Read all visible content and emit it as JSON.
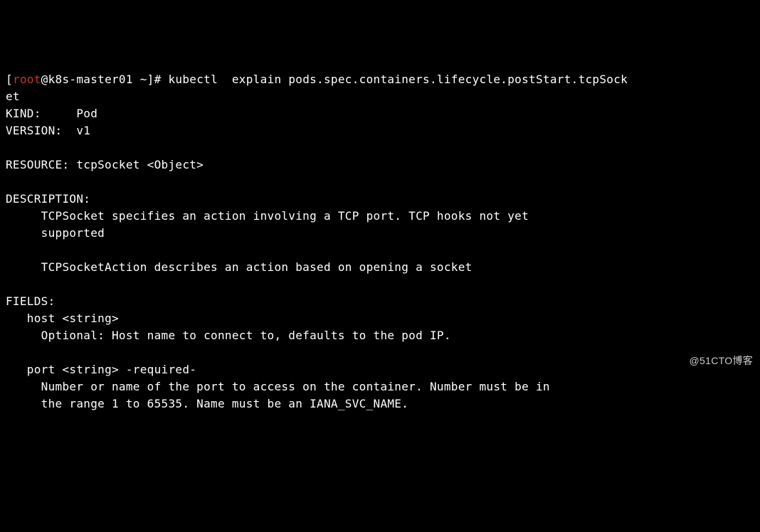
{
  "prompt": {
    "open": "[",
    "user": "root",
    "rest": "@k8s-master01 ~]# ",
    "command": "kubectl  explain pods.spec.containers.lifecycle.postStart.tcpSock"
  },
  "wrap_line": "et",
  "kind_line": "KIND:     Pod",
  "version_line": "VERSION:  v1",
  "resource_line": "RESOURCE: tcpSocket <Object>",
  "description_header": "DESCRIPTION:",
  "description_lines": {
    "d1": "     TCPSocket specifies an action involving a TCP port. TCP hooks not yet",
    "d2": "     supported",
    "d3": "     TCPSocketAction describes an action based on opening a socket"
  },
  "fields_header": "FIELDS:",
  "fields": {
    "host_line": "   host\t<string>",
    "host_desc": "     Optional: Host name to connect to, defaults to the pod IP.",
    "port_line": "   port\t<string> -required-",
    "port_desc1": "     Number or name of the port to access on the container. Number must be in",
    "port_desc2": "     the range 1 to 65535. Name must be an IANA_SVC_NAME."
  },
  "watermark": "@51CTO博客"
}
